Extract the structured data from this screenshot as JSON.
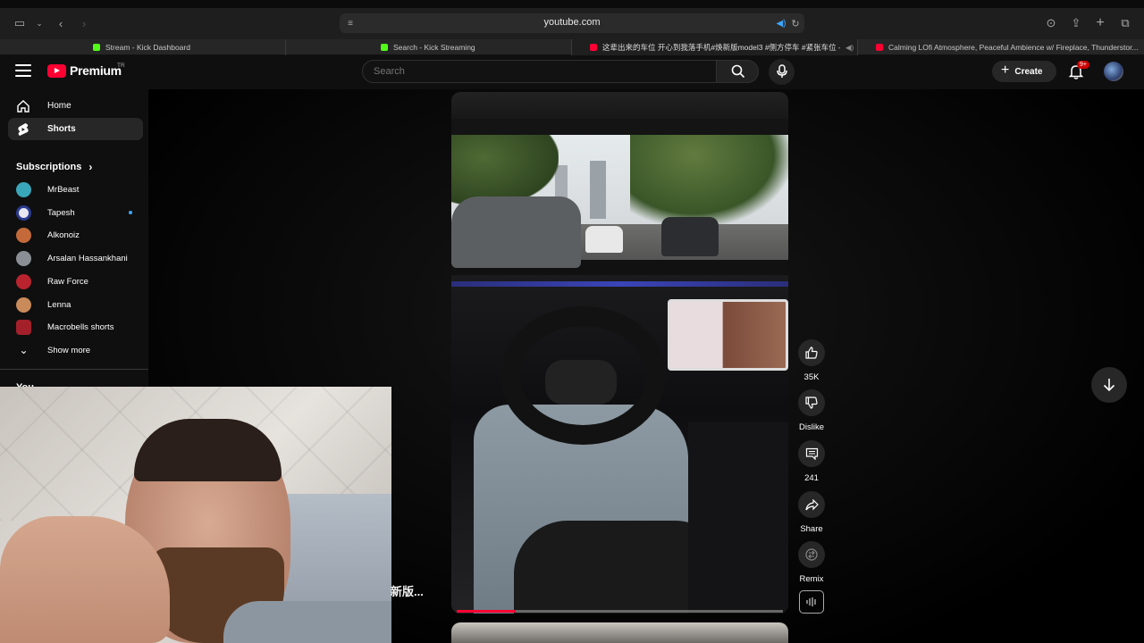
{
  "browser": {
    "url": "youtube.com",
    "tabs": [
      {
        "title": "Stream - Kick Dashboard",
        "favicon_color": "#53fc18",
        "active": false
      },
      {
        "title": "Search - Kick Streaming",
        "favicon_color": "#53fc18",
        "active": false
      },
      {
        "title": "这辈出来的车位 开心到我落手机#焕新版model3 #侧方停车 #紧张车位 -...",
        "favicon_color": "#ff0033",
        "active": true
      },
      {
        "title": "Calming LOfi Atmosphere, Peaceful Ambience w/ Fireplace, Thunderstor...",
        "favicon_color": "#ff0033",
        "active": false
      }
    ]
  },
  "header": {
    "logo_text": "Premium",
    "country_code": "TR",
    "search_placeholder": "Search",
    "create_label": "Create",
    "notification_count": "9+"
  },
  "sidebar": {
    "nav": [
      {
        "label": "Home",
        "icon": "home-icon",
        "active": false
      },
      {
        "label": "Shorts",
        "icon": "shorts-icon",
        "active": true
      }
    ],
    "subscriptions_title": "Subscriptions",
    "subscriptions": [
      {
        "name": "MrBeast",
        "color": "#3aa6b9",
        "new": false
      },
      {
        "name": "Tapesh",
        "color": "#e8e8f0",
        "new": true
      },
      {
        "name": "Alkonoiz",
        "color": "#c46a3a",
        "new": false
      },
      {
        "name": "Arsalan Hassankhani",
        "color": "#8a8f96",
        "new": false
      },
      {
        "name": "Raw Force",
        "color": "#b8232e",
        "new": false
      },
      {
        "name": "Lenna",
        "color": "#c98b5a",
        "new": false
      },
      {
        "name": "Macrobells shorts",
        "color": "#a3202a",
        "new": false
      }
    ],
    "show_more_label": "Show more",
    "you_label": "You"
  },
  "short": {
    "progress": 0.18,
    "caption_peek": "新版..."
  },
  "actions": {
    "like_count": "35K",
    "dislike_label": "Dislike",
    "comment_count": "241",
    "share_label": "Share",
    "remix_label": "Remix"
  }
}
